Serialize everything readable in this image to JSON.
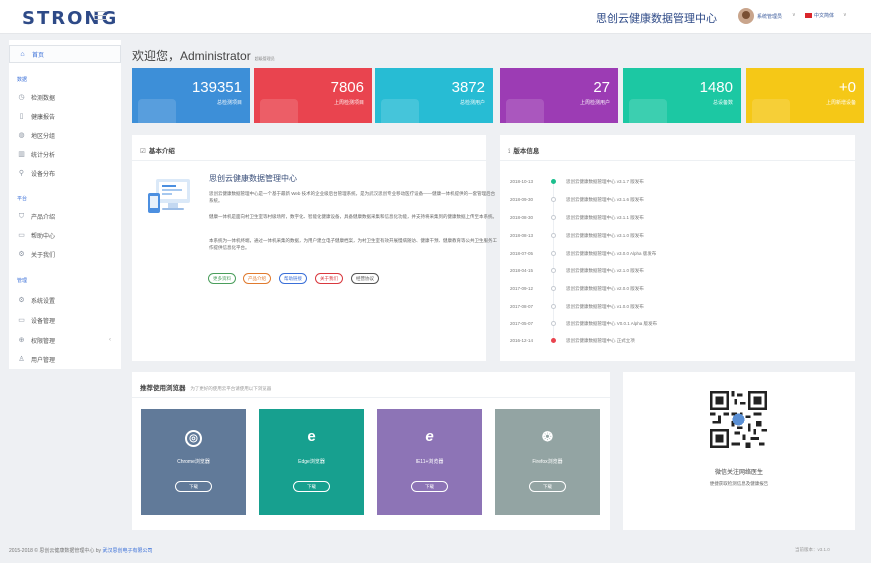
{
  "header": {
    "logo": "STRONG",
    "site_title": "思创云健康数据管理中心",
    "user_name": "系统管理员",
    "language": "中文简体"
  },
  "sidebar": {
    "home": "首页",
    "groups": {
      "data": "数据",
      "platform": "平台",
      "manage": "管理"
    },
    "data_items": [
      "检测数据",
      "健康报告",
      "地区分组",
      "统计分析",
      "设备分布"
    ],
    "platform_items": [
      "产品介绍",
      "帮助中心",
      "关于我们"
    ],
    "manage_items": [
      "系统设置",
      "设备管理",
      "权限管理",
      "用户管理"
    ]
  },
  "welcome": {
    "text": "欢迎您，Administrator",
    "role": "超级管理员"
  },
  "stats": [
    {
      "value": "139351",
      "label": "总检测项目",
      "color": "#3d8fd8"
    },
    {
      "value": "7806",
      "label": "上周检测项目",
      "color": "#e9444f"
    },
    {
      "value": "3872",
      "label": "总检测用户",
      "color": "#27bcd4"
    },
    {
      "value": "27",
      "label": "上周检测用户",
      "color": "#9c3cb4"
    },
    {
      "value": "1480",
      "label": "总设备数",
      "color": "#1cc8a3"
    },
    {
      "value": "+0",
      "label": "上周新增设备",
      "color": "#f5c817"
    }
  ],
  "intro": {
    "title": "基本介绍",
    "heading": "思创云健康数据管理中心",
    "paragraphs": [
      "思创云健康数据管理中心是一个基于最新 Web 技术的企业级后台管理系统，是为武汉思创专业移动医疗设备——健康一体机提供的一套管理后台系统。",
      "健康一体机是面向村卫生室等村级场所，数字化、智能化健康设备，具备健康数据采集和信息化功能，并支持将采集到的健康数据上传至本系统。",
      "本系统为一体机终端，通过一体机采集的数据，为用户建立电子健康档案，为村卫生室有效开展慢病随访、健康干预、健康教育等公共卫生服务工作提供信息化平台。"
    ],
    "tags": [
      "更多资料",
      "产品介绍",
      "帮助链接",
      "关于我们",
      "经营协议"
    ],
    "tag_colors": [
      "#4a9e5c",
      "#e07a2e",
      "#3a6fd8",
      "#d9383e",
      "#555555"
    ]
  },
  "versions": {
    "title": "版本信息",
    "items": [
      {
        "date": "2018-10-13",
        "text": "思创云健康数据管理中心 v3.1.7 版发布",
        "state": "current"
      },
      {
        "date": "2018-09-30",
        "text": "思创云健康数据管理中心 v3.1.6 版发布",
        "state": "normal"
      },
      {
        "date": "2018-08-30",
        "text": "思创云健康数据管理中心 v3.1.1 版发布",
        "state": "normal"
      },
      {
        "date": "2018-08-13",
        "text": "思创云健康数据管理中心 v3.1.0 版发布",
        "state": "normal"
      },
      {
        "date": "2018-07-05",
        "text": "思创云健康数据管理中心 v3.0.0 Alpha 版发布",
        "state": "normal"
      },
      {
        "date": "2018-04-15",
        "text": "思创云健康数据管理中心 v2.1.0 版发布",
        "state": "normal"
      },
      {
        "date": "2017-09-12",
        "text": "思创云健康数据管理中心 v2.0.0 版发布",
        "state": "normal"
      },
      {
        "date": "2017-08-07",
        "text": "思创云健康数据管理中心 v1.0.0 版发布",
        "state": "normal"
      },
      {
        "date": "2017-05-07",
        "text": "思创云健康数据管理中心 V0.0.1 Alpha 版发布",
        "state": "normal"
      },
      {
        "date": "2016-12-14",
        "text": "思创云健康数据管理中心 正式立项",
        "state": "origin"
      }
    ]
  },
  "browsers": {
    "title": "推荐使用浏览器",
    "subtitle": "为了更好的使用云平台请使用以下浏览器",
    "download_label": "下载",
    "items": [
      {
        "name": "Chrome浏览器",
        "icon": "chrome-icon",
        "color": "#617a99"
      },
      {
        "name": "Edge浏览器",
        "icon": "edge-icon",
        "color": "#17a08f"
      },
      {
        "name": "IE11+浏览器",
        "icon": "ie-icon",
        "color": "#8d74b6"
      },
      {
        "name": "Firefox浏览器",
        "icon": "firefox-icon",
        "color": "#93a4a3"
      }
    ]
  },
  "wechat": {
    "title": "微信关注网络医生",
    "subtitle": "便捷获取检测信息及健康报告"
  },
  "footer": {
    "copyright": "2015-2018 © 思创云健康数据管理中心 by",
    "company": "武汉思创电子有限公司",
    "version": "当前版本：v3.1.0"
  }
}
